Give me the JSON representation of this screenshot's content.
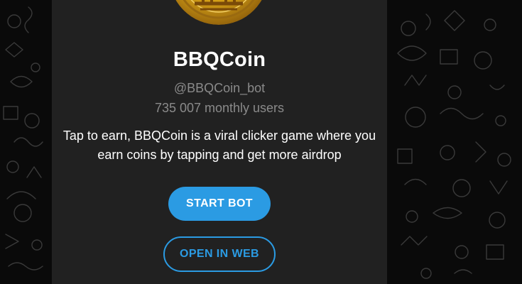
{
  "colors": {
    "background": "#0a0a0a",
    "card": "#212121",
    "accent": "#2b9be3",
    "title": "#ffffff",
    "muted": "#8a8a8a",
    "coin_gold": "#d4a017"
  },
  "background": {
    "pattern": "doodle-pattern"
  },
  "bot": {
    "avatar_icon": "gold-coin-icon",
    "name": "BBQCoin",
    "handle": "@BBQCoin_bot",
    "users": "735 007 monthly users",
    "description": "Tap to earn, BBQCoin is a viral clicker game where you earn coins by tapping and get more airdrop"
  },
  "actions": {
    "start_label": "START BOT",
    "web_label": "OPEN IN WEB"
  }
}
